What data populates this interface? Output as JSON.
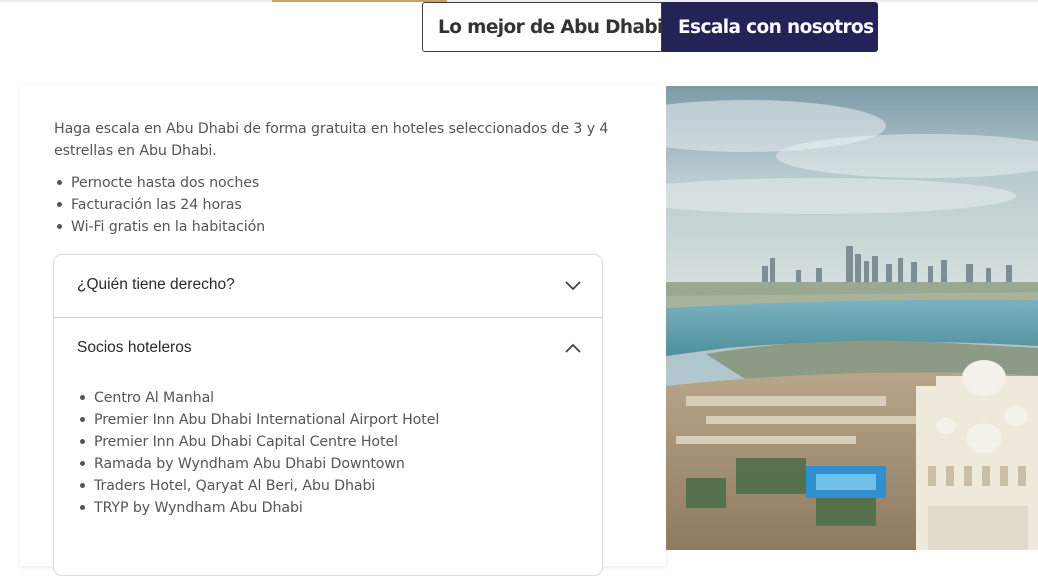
{
  "tabs": [
    {
      "label": "Lo mejor de Abu Dhabi",
      "active": false
    },
    {
      "label": "Escala con nosotros",
      "active": true
    }
  ],
  "intro": "Haga escala en Abu Dhabi de forma gratuita en hoteles seleccionados de 3 y 4 estrellas en Abu Dhabi.",
  "perks": [
    "Pernocte hasta dos noches",
    "Facturación las 24 horas",
    "Wi-Fi gratis en la habitación"
  ],
  "accordion": {
    "items": [
      {
        "title": "¿Quién tiene derecho?",
        "expanded": false,
        "icon": "chevron-down-icon"
      },
      {
        "title": "Socios hoteleros",
        "expanded": true,
        "icon": "chevron-up-icon"
      }
    ],
    "hotels": [
      "Centro Al Manhal",
      "Premier Inn Abu Dhabi International Airport Hotel",
      "Premier Inn Abu Dhabi Capital Centre Hotel",
      "Ramada by Wyndham Abu Dhabi Downtown",
      "Traders Hotel, Qaryat Al Beri, Abu Dhabi",
      "TRYP by Wyndham Abu Dhabi"
    ]
  },
  "colors": {
    "active_tab": "#242358",
    "accent": "#c8a35a"
  }
}
